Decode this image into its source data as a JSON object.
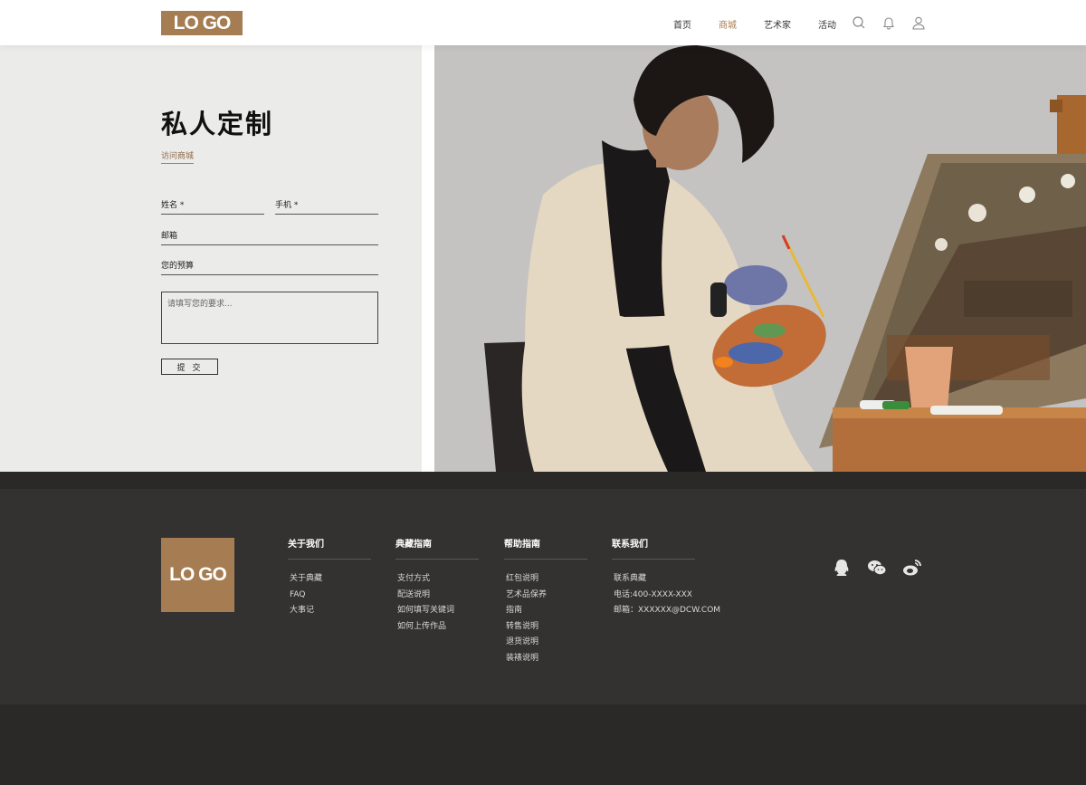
{
  "header": {
    "logo_text": "LO GO",
    "nav": [
      {
        "label": "首页",
        "active": false
      },
      {
        "label": "商城",
        "active": true
      },
      {
        "label": "艺术家",
        "active": false
      },
      {
        "label": "活动",
        "active": false
      }
    ],
    "icons": [
      "search-icon",
      "bell-icon",
      "user-icon"
    ]
  },
  "hero": {
    "title": "私人定制",
    "visit_link": "访问商城",
    "form": {
      "name_label": "姓名 *",
      "phone_label": "手机 *",
      "email_label": "邮箱",
      "budget_label": "您的预算",
      "requirements_placeholder": "请填写您的要求...",
      "submit_label": "提交"
    }
  },
  "footer": {
    "logo_text": "LO GO",
    "columns": [
      {
        "title": "关于我们",
        "items": [
          "关于典藏",
          "FAQ",
          "大事记"
        ]
      },
      {
        "title": "典藏指南",
        "items": [
          "支付方式",
          "配送说明",
          "如何填写关键词",
          "如何上传作品"
        ]
      },
      {
        "title": "帮助指南",
        "items": [
          "红包说明",
          "艺术品保养",
          "指南",
          "转售说明",
          "退货说明",
          "装裱说明"
        ]
      },
      {
        "title": "联系我们",
        "items": [
          "联系典藏",
          "电话:400-XXXX-XXX",
          "邮箱：XXXXXX@DCW.COM"
        ]
      }
    ],
    "social": [
      "qq-icon",
      "wechat-icon",
      "weibo-icon"
    ]
  },
  "colors": {
    "accent": "#a67d52",
    "form_bg": "#ebebe9",
    "footer_bg": "#333231",
    "footer_bottom_bg": "#2a2928"
  }
}
